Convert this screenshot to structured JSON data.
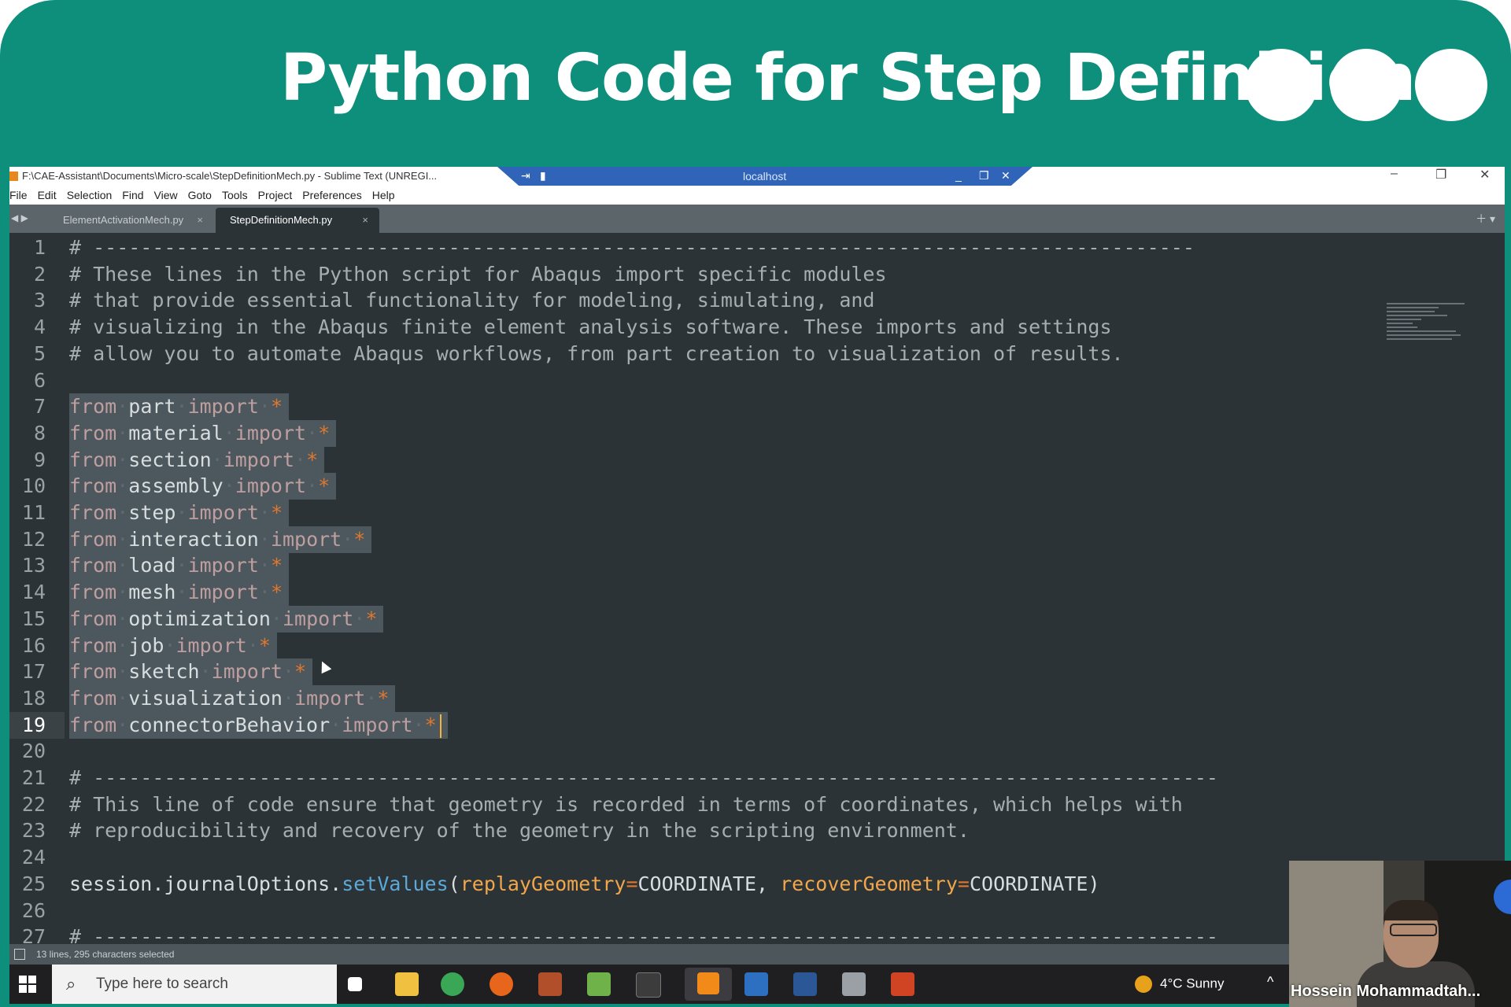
{
  "banner": {
    "title": "Python Code for Step Definition",
    "dots": [
      "dot",
      "dot",
      "dot"
    ],
    "background_color": "#0d8f7c"
  },
  "window": {
    "title": "F:\\CAE-Assistant\\Documents\\Micro-scale\\StepDefinitionMech.py - Sublime Text (UNREGI...",
    "remote_host": "localhost",
    "controls": [
      "minimize-icon",
      "restore-icon",
      "close-icon"
    ]
  },
  "menu": [
    "File",
    "Edit",
    "Selection",
    "Find",
    "View",
    "Goto",
    "Tools",
    "Project",
    "Preferences",
    "Help"
  ],
  "tabs": [
    {
      "label": "ElementActivationMech.py",
      "close": "×",
      "active": false
    },
    {
      "label": "StepDefinitionMech.py",
      "close": "×",
      "active": true
    }
  ],
  "editor": {
    "current_line": 19,
    "line_numbers": [
      "1",
      "2",
      "3",
      "4",
      "5",
      "6",
      "7",
      "8",
      "9",
      "10",
      "11",
      "12",
      "13",
      "14",
      "15",
      "16",
      "17",
      "18",
      "19",
      "20",
      "21",
      "22",
      "23",
      "24",
      "25",
      "26",
      "27"
    ],
    "comment_rule": "# ---------------------------------------------------------------------------------------------",
    "comment_rule_2": "# -----------------------------------------------------------------------------------------------",
    "header_comments": [
      "# These lines in the Python script for Abaqus import specific modules",
      "# that provide essential functionality for modeling, simulating, and",
      "# visualizing in the Abaqus finite element analysis software. These imports and settings",
      "# allow you to automate Abaqus workflows, from part creation to visualization of results."
    ],
    "import_keyword_from": "from",
    "import_keyword_import": "import",
    "import_star": "*",
    "import_modules": [
      "part",
      "material",
      "section",
      "assembly",
      "step",
      "interaction",
      "load",
      "mesh",
      "optimization",
      "job",
      "sketch",
      "visualization",
      "connectorBehavior"
    ],
    "journal_comments": [
      "# This line of code ensure that geometry is recorded in terms of coordinates, which helps with",
      "# reproducibility and recovery of the geometry in the scripting environment."
    ],
    "journal_code": {
      "object": "session.journalOptions.",
      "method": "setValues",
      "open": "(",
      "param1": "replayGeometry",
      "eq": "=",
      "value1": "COORDINATE",
      "sep": ", ",
      "param2": "recoverGeometry",
      "value2": "COORDINATE",
      "close": ")"
    }
  },
  "status": {
    "selection": "13 lines, 295 characters selected"
  },
  "taskbar": {
    "search_placeholder": "Type here to search",
    "weather": "4°C  Sunny",
    "apps": [
      "task-view-icon",
      "file-explorer-icon",
      "chrome-icon",
      "firefox-icon",
      "app-icon",
      "notepad-icon",
      "terminal-icon",
      "sublime-text-icon",
      "calculator-icon",
      "word-icon",
      "network-icon",
      "powerpoint-icon"
    ]
  },
  "webcam": {
    "name": "Hossein Mohammadtah..."
  }
}
